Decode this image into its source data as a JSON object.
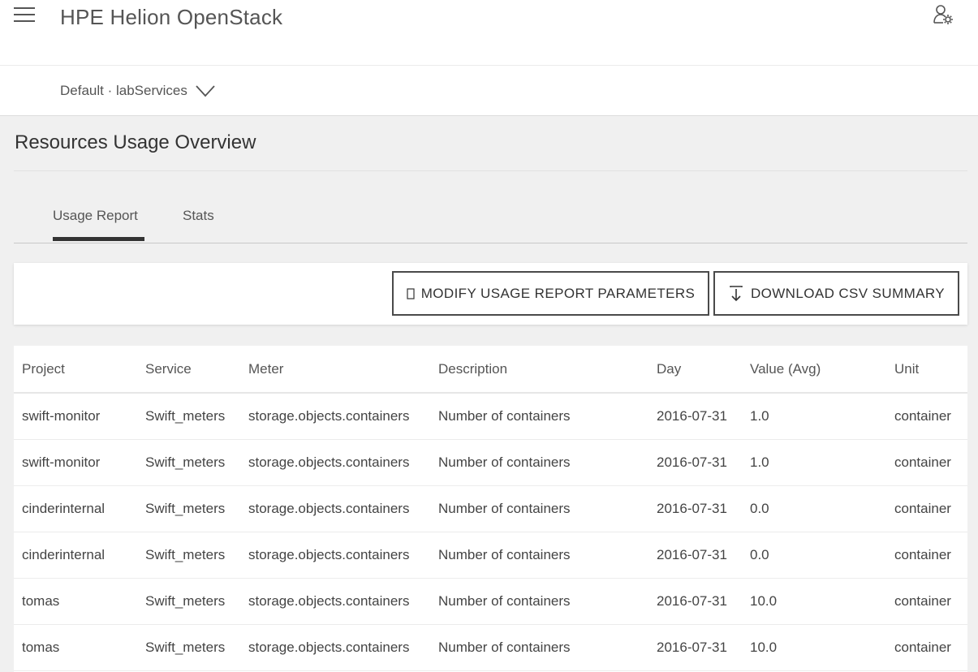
{
  "header": {
    "app_title": "HPE Helion OpenStack",
    "project_selector": "Default · labServices"
  },
  "page": {
    "title": "Resources Usage Overview"
  },
  "tabs": [
    {
      "label": "Usage Report",
      "active": true
    },
    {
      "label": "Stats",
      "active": false
    }
  ],
  "toolbar": {
    "modify_label": "MODIFY USAGE REPORT PARAMETERS",
    "download_label": "DOWNLOAD CSV SUMMARY"
  },
  "table": {
    "columns": [
      "Project",
      "Service",
      "Meter",
      "Description",
      "Day",
      "Value (Avg)",
      "Unit"
    ],
    "rows": [
      [
        "swift-monitor",
        "Swift_meters",
        "storage.objects.containers",
        "Number of containers",
        "2016-07-31",
        "1.0",
        "container"
      ],
      [
        "swift-monitor",
        "Swift_meters",
        "storage.objects.containers",
        "Number of containers",
        "2016-07-31",
        "1.0",
        "container"
      ],
      [
        "cinderinternal",
        "Swift_meters",
        "storage.objects.containers",
        "Number of containers",
        "2016-07-31",
        "0.0",
        "container"
      ],
      [
        "cinderinternal",
        "Swift_meters",
        "storage.objects.containers",
        "Number of containers",
        "2016-07-31",
        "0.0",
        "container"
      ],
      [
        "tomas",
        "Swift_meters",
        "storage.objects.containers",
        "Number of containers",
        "2016-07-31",
        "10.0",
        "container"
      ],
      [
        "tomas",
        "Swift_meters",
        "storage.objects.containers",
        "Number of containers",
        "2016-07-31",
        "10.0",
        "container"
      ]
    ]
  },
  "icons": {
    "menu": "hamburger-icon",
    "user": "user-settings-icon",
    "dropdown": "chevron-down-icon",
    "modify": "placeholder-box-icon",
    "download": "download-icon"
  },
  "colors": {
    "header_bg": "#ffffff",
    "page_bg": "#f0f0f0",
    "text": "#333333",
    "button_border": "#4a4a4a"
  }
}
